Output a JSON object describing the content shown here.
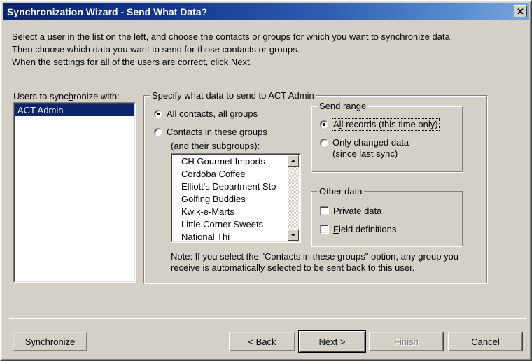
{
  "window": {
    "title": "Synchronization Wizard - Send What Data?",
    "close_label": "✕",
    "titlebar_gradient_start": "#0a246a",
    "titlebar_gradient_end": "#7ba7de",
    "face_color": "#d4d0c8",
    "selection_color": "#0a246a"
  },
  "instructions": {
    "line1": "Select a user in the list on the left, and choose the contacts or groups for which you want to synchronize data.",
    "line2": "Then choose which data you want to send for those contacts or groups.",
    "line3": "When the settings for all of the users are correct, click Next."
  },
  "users_panel": {
    "label": "Users to synchronize with:",
    "label_accel": "h",
    "items": [
      {
        "name": "ACT Admin",
        "selected": true
      }
    ]
  },
  "main_group": {
    "title": "Specify what data to send to ACT Admin",
    "radio_all": {
      "label": "All contacts, all groups",
      "accel": "A",
      "checked": true
    },
    "radio_groups": {
      "label": "Contacts in these groups",
      "accel": "C",
      "checked": false,
      "sublabel": "(and their subgroups):"
    },
    "groups_list": {
      "items": [
        "CH Gourmet Imports",
        "Cordoba Coffee",
        "Elliott's Department Sto",
        "Golfing Buddies",
        "Kwik-e-Marts",
        "Little Corner Sweets",
        "National Thi"
      ],
      "scroll_up_icon": "scroll-up-arrow",
      "scroll_down_icon": "scroll-down-arrow"
    },
    "note": "Note: If you select the \"Contacts in these groups\" option, any group you receive is automatically selected to be sent back to this user."
  },
  "send_range_group": {
    "title": "Send range",
    "option_all_records": {
      "label": "All records (this time only)",
      "accel": "l",
      "checked": true,
      "focused": true
    },
    "option_changed": {
      "label": "Only changed data",
      "accel": "g",
      "sublabel": "(since last sync)",
      "checked": false
    }
  },
  "other_data_group": {
    "title": "Other data",
    "checkbox_private": {
      "label": "Private data",
      "accel": "P",
      "checked": false
    },
    "checkbox_fields": {
      "label": "Field definitions",
      "accel": "F",
      "checked": false
    }
  },
  "buttons": {
    "synchronize": {
      "label": "Synchronize",
      "enabled": true,
      "default": false
    },
    "back": {
      "label": "< Back",
      "accel": "B",
      "enabled": true,
      "default": false
    },
    "next": {
      "label": "Next >",
      "accel": "N",
      "enabled": true,
      "default": true
    },
    "finish": {
      "label": "Finish",
      "enabled": false,
      "default": false
    },
    "cancel": {
      "label": "Cancel",
      "enabled": true,
      "default": false
    }
  }
}
